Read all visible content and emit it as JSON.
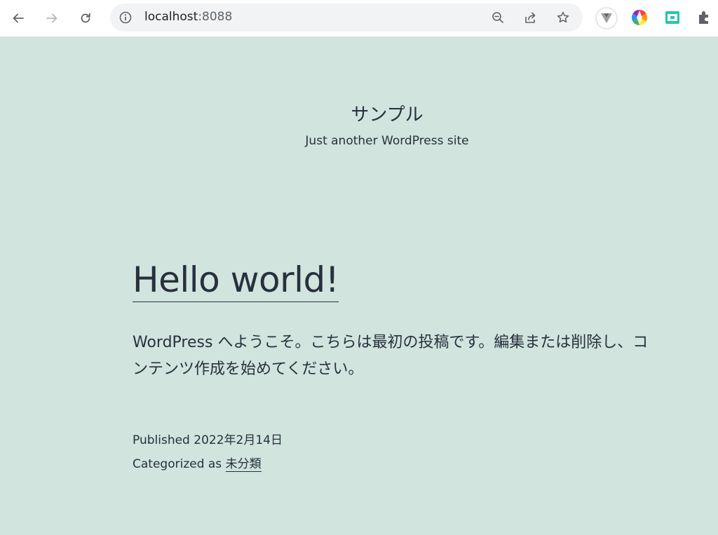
{
  "browser": {
    "url_host": "localhost",
    "url_port": ":8088"
  },
  "site": {
    "title": "サンプル",
    "description": "Just another WordPress site"
  },
  "post": {
    "title": "Hello world!",
    "body": "WordPress へようこそ。こちらは最初の投稿です。編集または削除し、コンテンツ作成を始めてください。",
    "published_label": "Published",
    "published_date": "2022年2月14日",
    "categorized_label": "Categorized as",
    "category": "未分類"
  },
  "colors": {
    "page_bg": "#d1e4dd",
    "text": "#28303d"
  }
}
